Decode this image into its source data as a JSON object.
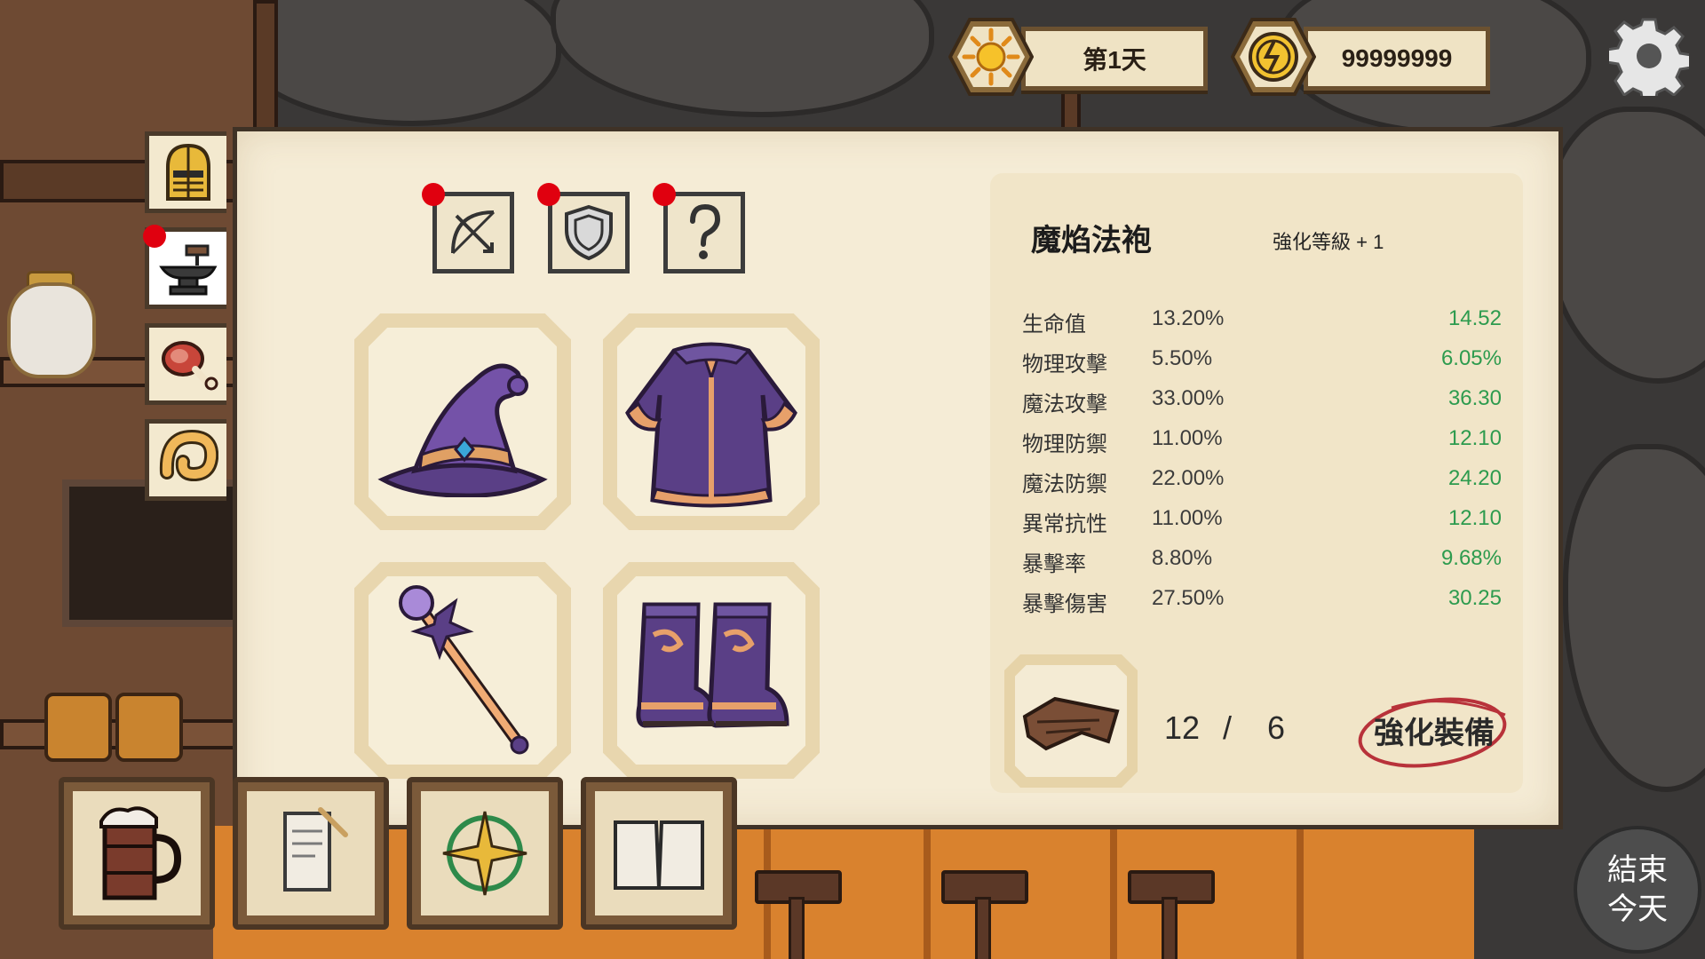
{
  "hud": {
    "day_label": "第1天",
    "currency_value": "99999999",
    "day_icon": "sun-icon",
    "currency_icon": "coin-icon",
    "settings_icon": "gear-icon"
  },
  "side_tabs": [
    {
      "name": "helmet-tab",
      "icon": "helmet-icon",
      "has_alert": false
    },
    {
      "name": "anvil-tab",
      "icon": "anvil-icon",
      "has_alert": true
    },
    {
      "name": "meat-tab",
      "icon": "meat-icon",
      "has_alert": false
    },
    {
      "name": "horn-tab",
      "icon": "horn-icon",
      "has_alert": false
    }
  ],
  "category_tabs": [
    {
      "name": "weapon-tab",
      "icon": "bow-crossed-icon",
      "has_alert": true
    },
    {
      "name": "armor-tab",
      "icon": "shield-icon",
      "has_alert": true
    },
    {
      "name": "misc-tab",
      "icon": "question-icon",
      "has_alert": true
    }
  ],
  "equipment_slots": [
    {
      "name": "hat-slot",
      "icon": "wizard-hat-icon"
    },
    {
      "name": "robe-slot",
      "icon": "wizard-robe-icon"
    },
    {
      "name": "staff-slot",
      "icon": "magic-staff-icon"
    },
    {
      "name": "boots-slot",
      "icon": "boots-icon"
    }
  ],
  "item": {
    "name": "魔焰法袍",
    "enhance_level": "強化等級 + 1",
    "stats": [
      {
        "label": "生命值",
        "value": "13.20%",
        "next": "14.52"
      },
      {
        "label": "物理攻擊",
        "value": "5.50%",
        "next": "6.05%"
      },
      {
        "label": "魔法攻擊",
        "value": "33.00%",
        "next": "36.30"
      },
      {
        "label": "物理防禦",
        "value": "11.00%",
        "next": "12.10"
      },
      {
        "label": "魔法防禦",
        "value": "22.00%",
        "next": "24.20"
      },
      {
        "label": "異常抗性",
        "value": "11.00%",
        "next": "12.10"
      },
      {
        "label": "暴擊率",
        "value": "8.80%",
        "next": "9.68%"
      },
      {
        "label": "暴擊傷害",
        "value": "27.50%",
        "next": "30.25"
      }
    ],
    "material_icon": "wood-plank-icon",
    "material_owned": "12",
    "material_sep": "/",
    "material_required": "6",
    "enhance_button": "強化裝備"
  },
  "bottom_bar": [
    {
      "name": "tavern-mug-button",
      "icon": "mug-icon"
    },
    {
      "name": "quest-scroll-button",
      "icon": "scroll-icon"
    },
    {
      "name": "compass-button",
      "icon": "compass-icon"
    },
    {
      "name": "book-button",
      "icon": "book-icon"
    }
  ],
  "end_day": {
    "line1": "結束",
    "line2": "今天"
  },
  "colors": {
    "parchment": "#f5ecd6",
    "stat_increase": "#2d9b4e",
    "alert_dot": "#e0000f",
    "button_circle": "#b8323a"
  }
}
